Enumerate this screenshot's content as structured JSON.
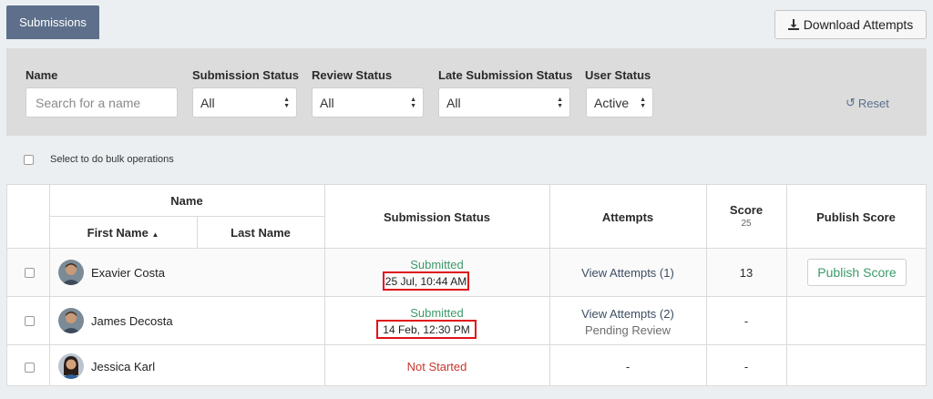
{
  "header": {
    "tab_label": "Submissions",
    "download_label": "Download Attempts"
  },
  "filters": {
    "name_label": "Name",
    "name_placeholder": "Search for a name",
    "submission_status": {
      "label": "Submission Status",
      "value": "All"
    },
    "review_status": {
      "label": "Review Status",
      "value": "All"
    },
    "late_status": {
      "label": "Late Submission Status",
      "value": "All"
    },
    "user_status": {
      "label": "User Status",
      "value": "Active"
    },
    "reset_label": "Reset"
  },
  "bulk_label": "Select to do bulk operations",
  "table": {
    "headers": {
      "name": "Name",
      "first_name": "First Name",
      "last_name": "Last Name",
      "submission_status": "Submission Status",
      "attempts": "Attempts",
      "score": "Score",
      "score_max": "25",
      "publish": "Publish Score"
    },
    "rows": [
      {
        "name": "Exavier Costa",
        "status": "Submitted",
        "date": "25 Jul, 10:44 AM",
        "attempts": "View Attempts (1)",
        "attempts_note": "",
        "score": "13",
        "publish": "Publish Score"
      },
      {
        "name": "James Decosta",
        "status": "Submitted",
        "date": "14 Feb, 12:30 PM",
        "attempts": "View Attempts (2)",
        "attempts_note": "Pending Review",
        "score": "-",
        "publish": ""
      },
      {
        "name": "Jessica Karl",
        "status": "Not Started",
        "date": "",
        "attempts": "-",
        "attempts_note": "",
        "score": "-",
        "publish": ""
      }
    ]
  },
  "colors": {
    "tab_bg": "#5d6f8a",
    "submitted": "#3c9a6a",
    "not_started": "#c8372d",
    "highlight_box": "#e0131a"
  }
}
